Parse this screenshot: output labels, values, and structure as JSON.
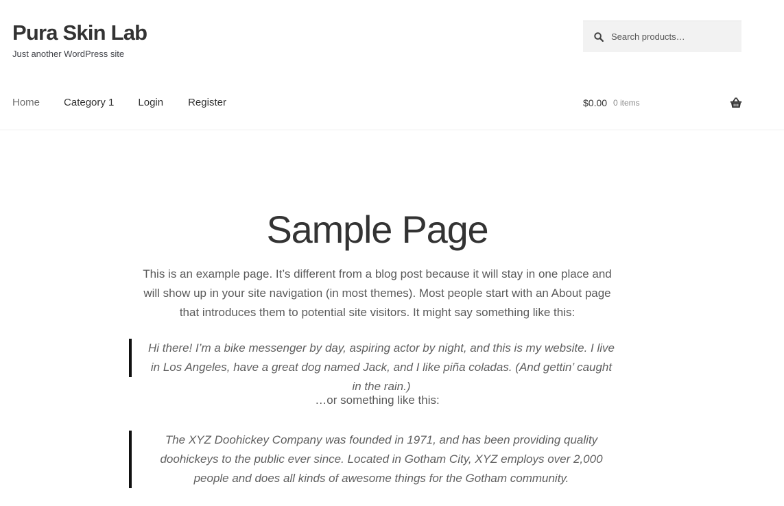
{
  "site": {
    "title": "Pura Skin Lab",
    "tagline": "Just another WordPress site"
  },
  "search": {
    "placeholder": "Search products…",
    "icon": "search-icon"
  },
  "nav": {
    "items": [
      {
        "label": "Home"
      },
      {
        "label": "Category 1"
      },
      {
        "label": "Login"
      },
      {
        "label": "Register"
      }
    ]
  },
  "cart": {
    "amount": "$0.00",
    "count": "0 items",
    "icon": "basket-icon"
  },
  "page": {
    "title": "Sample Page",
    "intro": "This is an example page. It’s different from a blog post because it will stay in one place and will show up in your site navigation (in most themes). Most people start with an About page that introduces them to potential site visitors. It might say something like this:",
    "quote1": "Hi there! I’m a bike messenger by day, aspiring actor by night, and this is my website. I live in Los Angeles, have a great dog named Jack, and I like piña coladas. (And gettin’ caught in the rain.)",
    "or_text": "…or something like this:",
    "quote2": "The XYZ Doohickey Company was founded in 1971, and has been providing quality doohickeys to the public ever since. Located in Gotham City, XYZ employs over 2,000 people and does all kinds of awesome things for the Gotham community."
  },
  "colors": {
    "text": "#43454b",
    "heading": "#333333",
    "search_bg": "#f2f2f2",
    "quote_border": "#111111"
  }
}
